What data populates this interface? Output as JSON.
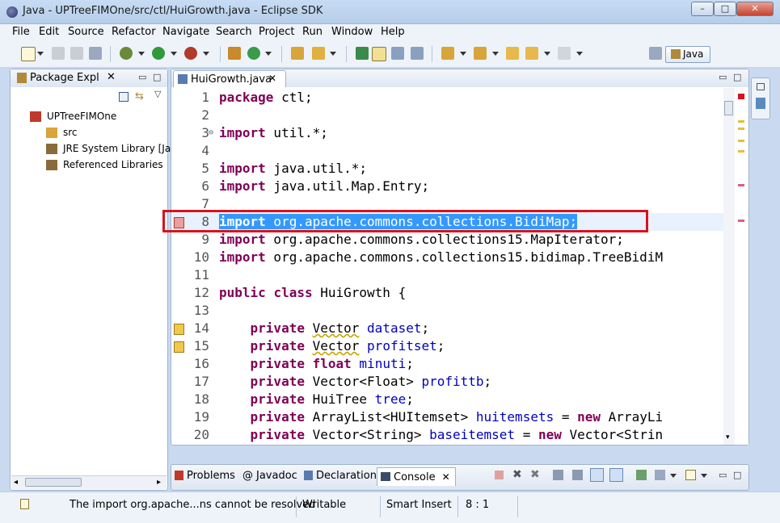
{
  "window": {
    "title": "Java - UPTreeFIMOne/src/ctl/HuiGrowth.java - Eclipse SDK",
    "minimize": "–",
    "maximize": "□",
    "close": "✕"
  },
  "menu": [
    "File",
    "Edit",
    "Source",
    "Refactor",
    "Navigate",
    "Search",
    "Project",
    "Run",
    "Window",
    "Help"
  ],
  "toolbar": {
    "perspective_label": "Java",
    "icons": [
      "new-wizard-icon",
      "save-icon",
      "save-all-icon",
      "print-icon",
      "debug-icon",
      "run-icon",
      "external-tools-icon",
      "new-java-project-icon",
      "new-class-icon",
      "open-type-icon",
      "search-icon",
      "toggle-mark-occurrences-icon",
      "toggle-highlight-icon",
      "block-selection-icon",
      "show-whitespace-icon",
      "next-annotation-icon",
      "previous-annotation-icon",
      "last-edit-icon",
      "back-icon",
      "forward-icon"
    ]
  },
  "package_explorer": {
    "tab_label": "Package Expl",
    "tree": [
      {
        "label": "UPTreeFIMOne",
        "icon": "java-project-icon",
        "level": 0
      },
      {
        "label": "src",
        "icon": "source-folder-icon",
        "level": 1
      },
      {
        "label": "JRE System Library [Ja",
        "icon": "library-icon",
        "level": 1
      },
      {
        "label": "Referenced Libraries",
        "icon": "library-icon",
        "level": 1
      }
    ]
  },
  "editor": {
    "tab_label": "HuiGrowth.java",
    "selected_line": 8,
    "lines": [
      {
        "n": "1",
        "segs": [
          [
            "kw",
            "package"
          ],
          [
            "",
            " ctl;"
          ]
        ]
      },
      {
        "n": "2",
        "segs": []
      },
      {
        "n": "3",
        "segs": [
          [
            "kw",
            "import"
          ],
          [
            "",
            " util.*;"
          ]
        ],
        "fold": true
      },
      {
        "n": "4",
        "segs": []
      },
      {
        "n": "5",
        "segs": [
          [
            "kw",
            "import"
          ],
          [
            "",
            " java.util.*;"
          ]
        ]
      },
      {
        "n": "6",
        "segs": [
          [
            "kw",
            "import"
          ],
          [
            "",
            " java.util.Map.Entry;"
          ]
        ]
      },
      {
        "n": "7",
        "segs": []
      },
      {
        "n": "8",
        "segs": [
          [
            "kw",
            "import"
          ],
          [
            "",
            " org.apache.commons.collections.BidiMap;"
          ]
        ],
        "error": true
      },
      {
        "n": "9",
        "segs": [
          [
            "kw",
            "import"
          ],
          [
            "",
            " org.apache.commons.collections15.MapIterator;"
          ]
        ]
      },
      {
        "n": "10",
        "segs": [
          [
            "kw",
            "import"
          ],
          [
            "",
            " org.apache.commons.collections15.bidimap.TreeBidiM"
          ]
        ]
      },
      {
        "n": "11",
        "segs": []
      },
      {
        "n": "12",
        "segs": [
          [
            "kw",
            "public"
          ],
          [
            "",
            " "
          ],
          [
            "kw",
            "class"
          ],
          [
            "",
            " HuiGrowth {"
          ]
        ]
      },
      {
        "n": "13",
        "segs": []
      },
      {
        "n": "14",
        "segs": [
          [
            "",
            "    "
          ],
          [
            "kw",
            "private"
          ],
          [
            "",
            " "
          ],
          [
            "squig",
            "Vector"
          ],
          [
            "",
            " "
          ],
          [
            "fld",
            "dataset"
          ],
          [
            "",
            ";"
          ]
        ],
        "warning": true
      },
      {
        "n": "15",
        "segs": [
          [
            "",
            "    "
          ],
          [
            "kw",
            "private"
          ],
          [
            "",
            " "
          ],
          [
            "squig",
            "Vector"
          ],
          [
            "",
            " "
          ],
          [
            "fld",
            "profitset"
          ],
          [
            "",
            ";"
          ]
        ],
        "warning": true
      },
      {
        "n": "16",
        "segs": [
          [
            "",
            "    "
          ],
          [
            "kw",
            "private"
          ],
          [
            "",
            " "
          ],
          [
            "kw",
            "float"
          ],
          [
            "",
            " "
          ],
          [
            "fld",
            "minuti"
          ],
          [
            "",
            ";"
          ]
        ]
      },
      {
        "n": "17",
        "segs": [
          [
            "",
            "    "
          ],
          [
            "kw",
            "private"
          ],
          [
            "",
            " Vector<Float> "
          ],
          [
            "fld",
            "profittb"
          ],
          [
            "",
            ";"
          ]
        ]
      },
      {
        "n": "18",
        "segs": [
          [
            "",
            "    "
          ],
          [
            "kw",
            "private"
          ],
          [
            "",
            " HuiTree "
          ],
          [
            "fld",
            "tree"
          ],
          [
            "",
            ";"
          ]
        ]
      },
      {
        "n": "19",
        "segs": [
          [
            "",
            "    "
          ],
          [
            "kw",
            "private"
          ],
          [
            "",
            " ArrayList<HUItemset> "
          ],
          [
            "fld",
            "huitemsets"
          ],
          [
            "",
            " = "
          ],
          [
            "kw",
            "new"
          ],
          [
            "",
            " ArrayLi"
          ]
        ]
      },
      {
        "n": "20",
        "segs": [
          [
            "",
            "    "
          ],
          [
            "kw",
            "private"
          ],
          [
            "",
            " Vector<String> "
          ],
          [
            "fld",
            "baseitemset"
          ],
          [
            "",
            " = "
          ],
          [
            "kw",
            "new"
          ],
          [
            "",
            " Vector<Strin"
          ]
        ]
      }
    ]
  },
  "bottom_tabs": [
    {
      "label": "Problems",
      "icon": "problems-icon"
    },
    {
      "label": "Javadoc",
      "icon": "javadoc-icon"
    },
    {
      "label": "Declaration",
      "icon": "declaration-icon"
    },
    {
      "label": "Console",
      "icon": "console-icon",
      "active": true
    }
  ],
  "status": {
    "message": "The import org.apache...ns cannot be resolved",
    "writable": "Writable",
    "insert_mode": "Smart Insert",
    "position": "8 : 1"
  },
  "colors": {
    "keyword": "#7f0055",
    "field": "#0000c0",
    "selection": "#3399ff",
    "highlight_box": "#d9121c"
  }
}
